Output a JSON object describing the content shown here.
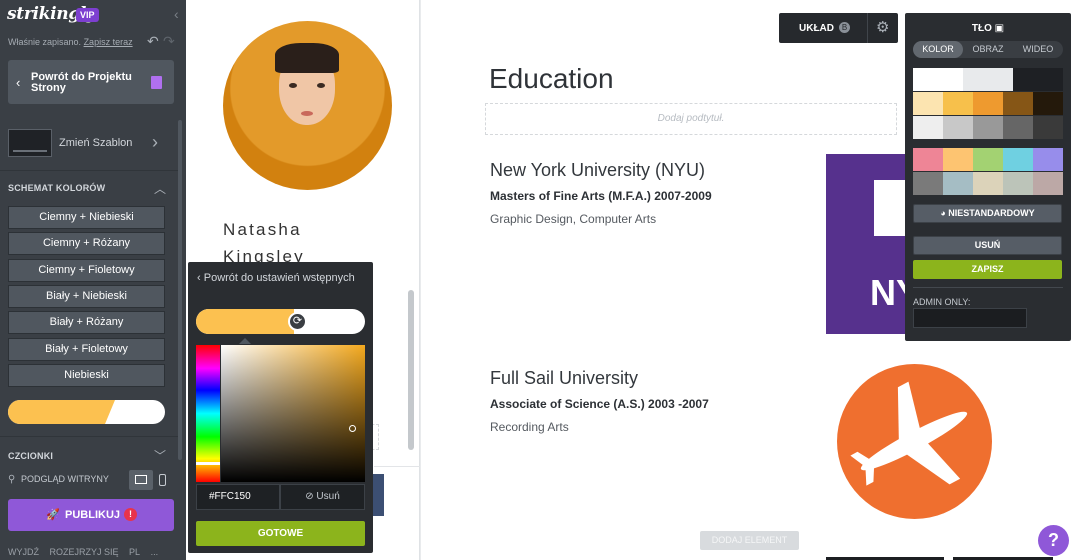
{
  "sidebar": {
    "logo": "strikingly",
    "vip": "VIP",
    "saved_text": "Właśnie zapisano.",
    "save_now": "Zapisz teraz",
    "back_label": "Powrót do Projektu Strony",
    "change_template": "Zmień Szablon",
    "color_schemes_title": "SCHEMAT KOLORÓW",
    "color_schemes": [
      "Ciemny + Niebieski",
      "Ciemny + Różany",
      "Ciemny + Fioletowy",
      "Biały + Niebieski",
      "Biały + Różany",
      "Biały + Fioletowy",
      "Niebieski"
    ],
    "custom_scheme_color": "#FCC150",
    "fonts_title": "CZCIONKI",
    "preview_label": "PODGLĄD WITRYNY",
    "publish": "PUBLIKUJ",
    "publish_alert": "!",
    "bottom_links": [
      "WYJDŹ",
      "ROZEJRZYJ SIĘ",
      "PL",
      "..."
    ]
  },
  "profile": {
    "name_line1": "Natasha",
    "name_line2": "Kingsley"
  },
  "main": {
    "heading": "Education",
    "subtitle_placeholder": "Dodaj podtytuł.",
    "entries": [
      {
        "school": "New York University (NYU)",
        "degree": "Masters of Fine Arts (M.F.A.) 2007-2009",
        "field": "Graphic Design, Computer Arts",
        "logo_text": "NY",
        "logo_color": "#56318D"
      },
      {
        "school": "Full Sail University",
        "degree": "Associate of Science (A.S.) 2003 -2007",
        "field": "Recording Arts",
        "logo_color": "#EF6F2F"
      }
    ],
    "add_element": "DODAJ ELEMENT",
    "help": "?"
  },
  "layout_bar": {
    "label": "UKŁAD",
    "badge": "B"
  },
  "bg_panel": {
    "title": "TŁO",
    "tabs": [
      "KOLOR",
      "OBRAZ",
      "WIDEO"
    ],
    "active_tab": "KOLOR",
    "swatches_row1": [
      "#FFFFFF",
      "#E8EAEC",
      "#1E2024"
    ],
    "swatches_row2": [
      "#FCE4B0",
      "#F7C04B",
      "#EE9A2F",
      "#865616",
      "#24190B"
    ],
    "swatches_row3": [
      "#EEEEEE",
      "#C8C8C8",
      "#999999",
      "#666666",
      "#3A3A3A"
    ],
    "swatches_row4": [
      "#EE8596",
      "#FDC471",
      "#A3D272",
      "#6FD0E1",
      "#978DEB"
    ],
    "swatches_row5": [
      "#7A7A7A",
      "#A5BDC4",
      "#DCD3BA",
      "#BCC4B9",
      "#BCA8A6"
    ],
    "custom_btn": "NIESTANDARDOWY",
    "remove_btn": "USUŃ",
    "save_btn": "ZAPISZ",
    "admin_label": "ADMIN ONLY:"
  },
  "color_picker": {
    "back": "Powrót do ustawień wstępnych",
    "hex": "#FFC150",
    "remove": "Usuń",
    "done": "GOTOWE",
    "selected_color": "#FCC150"
  }
}
